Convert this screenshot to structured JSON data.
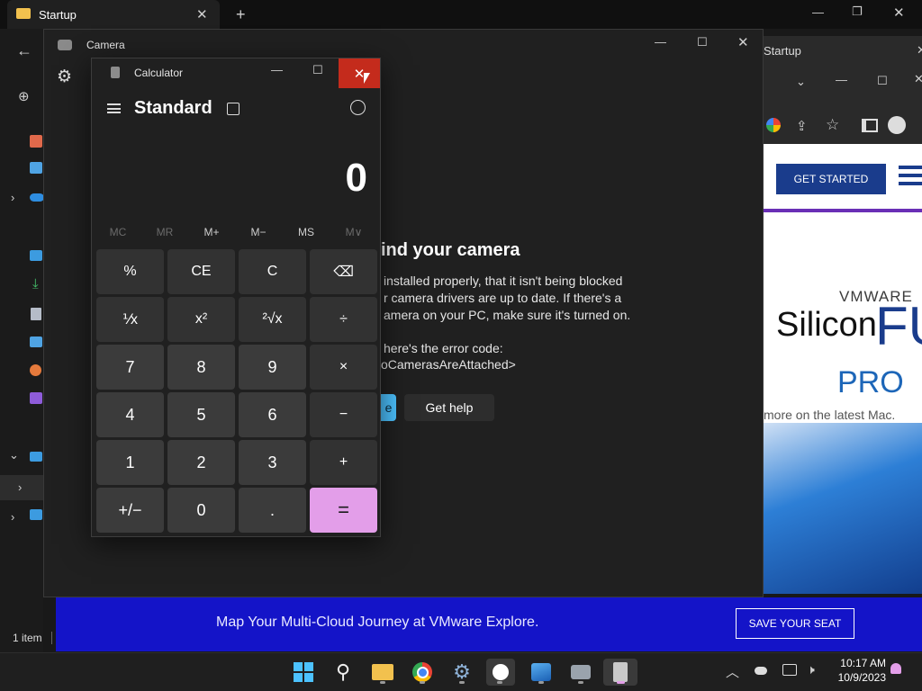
{
  "colors": {
    "accent": "#e39ee9",
    "close_red": "#c42b1c",
    "banner_blue": "#1414c8",
    "web_navy": "#1a3c8c"
  },
  "explorer": {
    "tab_title": "Startup",
    "status": "1 item"
  },
  "browser": {
    "tab_title": "Startup"
  },
  "web": {
    "get_started": "GET STARTED",
    "vmware": "VMWARE",
    "silicon": "Silicon",
    "fu": "FU",
    "pro": "PRO",
    "tagline": "more on the latest Mac."
  },
  "banner": {
    "text": "Map Your Multi-Cloud Journey at VMware Explore.",
    "button": "SAVE YOUR SEAT"
  },
  "camera": {
    "title": "Camera",
    "heading": "ind your camera",
    "line1": "installed properly, that it isn't being blocked",
    "line2": "r camera drivers are up to date. If there's a",
    "line3": "amera on your PC, make sure it's turned on.",
    "line4": "here's the error code:",
    "line5": "oCamerasAreAttached>",
    "btn_partial": "e",
    "get_help": "Get help"
  },
  "calculator": {
    "title": "Calculator",
    "mode": "Standard",
    "display": "0",
    "memory": [
      "MC",
      "MR",
      "M+",
      "M−",
      "MS",
      "M∨"
    ],
    "keys": [
      "%",
      "CE",
      "C",
      "⌫",
      "⅟x",
      "x²",
      "²√x",
      "÷",
      "7",
      "8",
      "9",
      "×",
      "4",
      "5",
      "6",
      "−",
      "1",
      "2",
      "3",
      "+",
      "+/−",
      "0",
      ".",
      "="
    ]
  },
  "taskbar": {
    "time": "10:17 AM",
    "date": "10/9/2023",
    "icons": [
      "start-icon",
      "search-icon",
      "file-explorer-icon",
      "chrome-icon",
      "settings-icon",
      "app-icon",
      "photos-icon",
      "camera-icon",
      "calculator-icon"
    ]
  }
}
